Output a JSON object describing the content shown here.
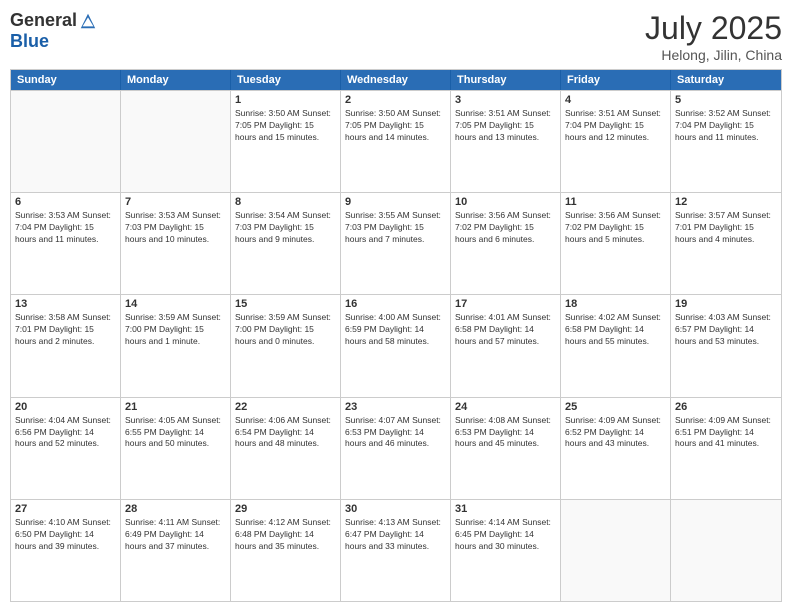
{
  "header": {
    "logo_general": "General",
    "logo_blue": "Blue",
    "month_year": "July 2025",
    "location": "Helong, Jilin, China"
  },
  "weekdays": [
    "Sunday",
    "Monday",
    "Tuesday",
    "Wednesday",
    "Thursday",
    "Friday",
    "Saturday"
  ],
  "weeks": [
    [
      {
        "day": "",
        "info": ""
      },
      {
        "day": "",
        "info": ""
      },
      {
        "day": "1",
        "info": "Sunrise: 3:50 AM\nSunset: 7:05 PM\nDaylight: 15 hours\nand 15 minutes."
      },
      {
        "day": "2",
        "info": "Sunrise: 3:50 AM\nSunset: 7:05 PM\nDaylight: 15 hours\nand 14 minutes."
      },
      {
        "day": "3",
        "info": "Sunrise: 3:51 AM\nSunset: 7:05 PM\nDaylight: 15 hours\nand 13 minutes."
      },
      {
        "day": "4",
        "info": "Sunrise: 3:51 AM\nSunset: 7:04 PM\nDaylight: 15 hours\nand 12 minutes."
      },
      {
        "day": "5",
        "info": "Sunrise: 3:52 AM\nSunset: 7:04 PM\nDaylight: 15 hours\nand 11 minutes."
      }
    ],
    [
      {
        "day": "6",
        "info": "Sunrise: 3:53 AM\nSunset: 7:04 PM\nDaylight: 15 hours\nand 11 minutes."
      },
      {
        "day": "7",
        "info": "Sunrise: 3:53 AM\nSunset: 7:03 PM\nDaylight: 15 hours\nand 10 minutes."
      },
      {
        "day": "8",
        "info": "Sunrise: 3:54 AM\nSunset: 7:03 PM\nDaylight: 15 hours\nand 9 minutes."
      },
      {
        "day": "9",
        "info": "Sunrise: 3:55 AM\nSunset: 7:03 PM\nDaylight: 15 hours\nand 7 minutes."
      },
      {
        "day": "10",
        "info": "Sunrise: 3:56 AM\nSunset: 7:02 PM\nDaylight: 15 hours\nand 6 minutes."
      },
      {
        "day": "11",
        "info": "Sunrise: 3:56 AM\nSunset: 7:02 PM\nDaylight: 15 hours\nand 5 minutes."
      },
      {
        "day": "12",
        "info": "Sunrise: 3:57 AM\nSunset: 7:01 PM\nDaylight: 15 hours\nand 4 minutes."
      }
    ],
    [
      {
        "day": "13",
        "info": "Sunrise: 3:58 AM\nSunset: 7:01 PM\nDaylight: 15 hours\nand 2 minutes."
      },
      {
        "day": "14",
        "info": "Sunrise: 3:59 AM\nSunset: 7:00 PM\nDaylight: 15 hours\nand 1 minute."
      },
      {
        "day": "15",
        "info": "Sunrise: 3:59 AM\nSunset: 7:00 PM\nDaylight: 15 hours\nand 0 minutes."
      },
      {
        "day": "16",
        "info": "Sunrise: 4:00 AM\nSunset: 6:59 PM\nDaylight: 14 hours\nand 58 minutes."
      },
      {
        "day": "17",
        "info": "Sunrise: 4:01 AM\nSunset: 6:58 PM\nDaylight: 14 hours\nand 57 minutes."
      },
      {
        "day": "18",
        "info": "Sunrise: 4:02 AM\nSunset: 6:58 PM\nDaylight: 14 hours\nand 55 minutes."
      },
      {
        "day": "19",
        "info": "Sunrise: 4:03 AM\nSunset: 6:57 PM\nDaylight: 14 hours\nand 53 minutes."
      }
    ],
    [
      {
        "day": "20",
        "info": "Sunrise: 4:04 AM\nSunset: 6:56 PM\nDaylight: 14 hours\nand 52 minutes."
      },
      {
        "day": "21",
        "info": "Sunrise: 4:05 AM\nSunset: 6:55 PM\nDaylight: 14 hours\nand 50 minutes."
      },
      {
        "day": "22",
        "info": "Sunrise: 4:06 AM\nSunset: 6:54 PM\nDaylight: 14 hours\nand 48 minutes."
      },
      {
        "day": "23",
        "info": "Sunrise: 4:07 AM\nSunset: 6:53 PM\nDaylight: 14 hours\nand 46 minutes."
      },
      {
        "day": "24",
        "info": "Sunrise: 4:08 AM\nSunset: 6:53 PM\nDaylight: 14 hours\nand 45 minutes."
      },
      {
        "day": "25",
        "info": "Sunrise: 4:09 AM\nSunset: 6:52 PM\nDaylight: 14 hours\nand 43 minutes."
      },
      {
        "day": "26",
        "info": "Sunrise: 4:09 AM\nSunset: 6:51 PM\nDaylight: 14 hours\nand 41 minutes."
      }
    ],
    [
      {
        "day": "27",
        "info": "Sunrise: 4:10 AM\nSunset: 6:50 PM\nDaylight: 14 hours\nand 39 minutes."
      },
      {
        "day": "28",
        "info": "Sunrise: 4:11 AM\nSunset: 6:49 PM\nDaylight: 14 hours\nand 37 minutes."
      },
      {
        "day": "29",
        "info": "Sunrise: 4:12 AM\nSunset: 6:48 PM\nDaylight: 14 hours\nand 35 minutes."
      },
      {
        "day": "30",
        "info": "Sunrise: 4:13 AM\nSunset: 6:47 PM\nDaylight: 14 hours\nand 33 minutes."
      },
      {
        "day": "31",
        "info": "Sunrise: 4:14 AM\nSunset: 6:45 PM\nDaylight: 14 hours\nand 30 minutes."
      },
      {
        "day": "",
        "info": ""
      },
      {
        "day": "",
        "info": ""
      }
    ]
  ]
}
